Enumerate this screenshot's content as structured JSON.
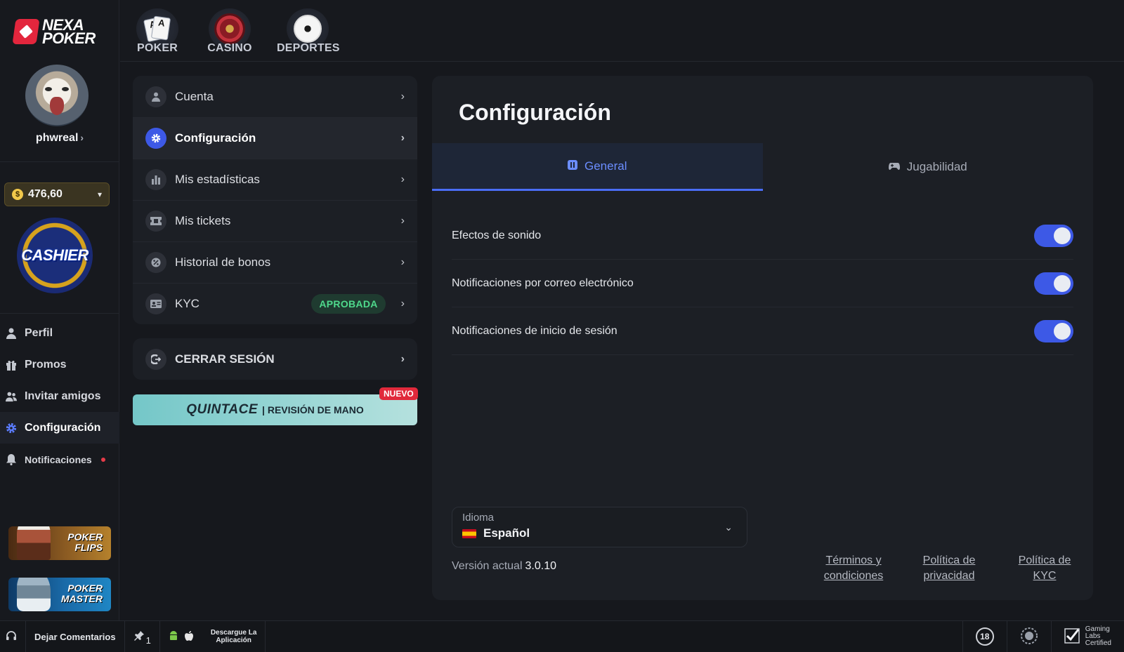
{
  "brand": {
    "line1": "NEXA",
    "line2": "POKER"
  },
  "user": {
    "name": "phwreal",
    "chevron": "›"
  },
  "balance": {
    "currency_symbol": "$",
    "amount": "476,60"
  },
  "cashier_label": "CASHIER",
  "sidebar": {
    "items": [
      {
        "label": "Perfil",
        "icon": "user-icon"
      },
      {
        "label": "Promos",
        "icon": "gift-icon"
      },
      {
        "label": "Invitar amigos",
        "icon": "users-icon"
      },
      {
        "label": "Configuración",
        "icon": "gear-icon",
        "active": true
      },
      {
        "label": "Notificaciones",
        "icon": "bell-icon",
        "has_alert": true
      }
    ],
    "promos": [
      {
        "line1": "POKER",
        "line2": "FLIPS"
      },
      {
        "line1": "POKER",
        "line2": "MASTER"
      }
    ]
  },
  "topnav": [
    {
      "label": "POKER",
      "icon": "cards-icon"
    },
    {
      "label": "CASINO",
      "icon": "roulette-icon"
    },
    {
      "label": "DEPORTES",
      "icon": "soccer-ball-icon"
    }
  ],
  "menu": {
    "items": [
      {
        "label": "Cuenta",
        "icon": "user-icon"
      },
      {
        "label": "Configuración",
        "icon": "gear-icon",
        "active": true
      },
      {
        "label": "Mis estadísticas",
        "icon": "bar-chart-icon"
      },
      {
        "label": "Mis tickets",
        "icon": "ticket-icon"
      },
      {
        "label": "Historial de bonos",
        "icon": "percent-icon"
      },
      {
        "label": "KYC",
        "icon": "id-card-icon",
        "badge": "APROBADA"
      }
    ],
    "logout": "CERRAR SESIÓN",
    "banner": {
      "brand": "QUINTACE",
      "text": "| REVISIÓN DE MANO",
      "tag": "NUEVO"
    }
  },
  "settings": {
    "title": "Configuración",
    "tabs": [
      {
        "label": "General",
        "icon": "general-icon",
        "active": true
      },
      {
        "label": "Jugabilidad",
        "icon": "gamepad-icon"
      }
    ],
    "toggles": [
      {
        "label": "Efectos de sonido",
        "on": true
      },
      {
        "label": "Notificaciones por correo electrónico",
        "on": true
      },
      {
        "label": "Notificaciones de inicio de sesión",
        "on": true
      }
    ],
    "language": {
      "label": "Idioma",
      "value": "Español"
    },
    "version": {
      "label": "Versión actual",
      "value": "3.0.10"
    },
    "links": [
      {
        "line1": "Términos y",
        "line2": "condiciones"
      },
      {
        "line1": "Política de",
        "line2": "privacidad"
      },
      {
        "line1": "Política de",
        "line2": "KYC"
      }
    ]
  },
  "footer": {
    "feedback": "Dejar Comentarios",
    "pin_count": "1",
    "download_line1": "Descargue La",
    "download_line2": "Aplicación",
    "age": "18",
    "gla_line1": "Gaming",
    "gla_line2": "Labs",
    "gla_line3": "Certified"
  },
  "colors": {
    "accent": "#3d59e6",
    "badge_green": "#4fd98c",
    "alert_red": "#e53b49"
  }
}
